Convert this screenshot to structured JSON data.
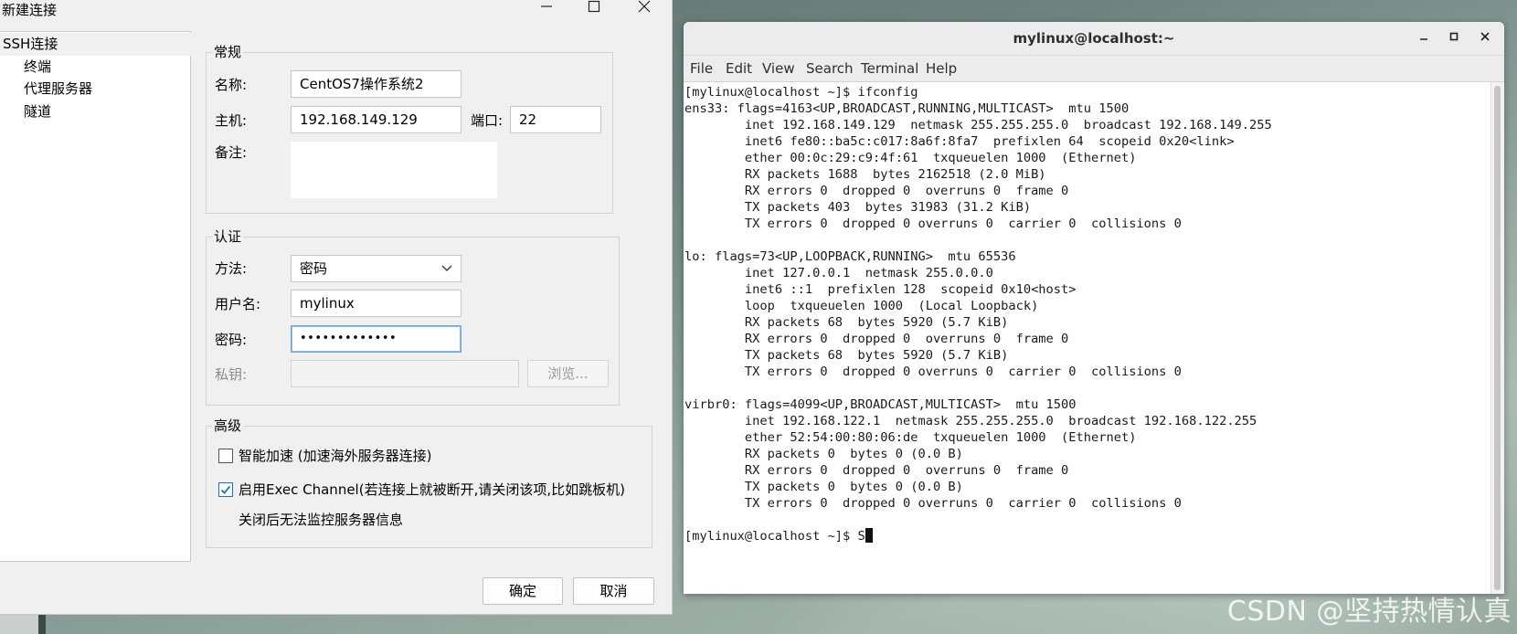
{
  "dialog": {
    "title": "新建连接",
    "tree": [
      "SSH连接",
      "终端",
      "代理服务器",
      "隧道"
    ],
    "general": {
      "title": "常规",
      "name_label": "名称:",
      "name_value": "CentOS7操作系统2",
      "host_label": "主机:",
      "host_value": "192.168.149.129",
      "port_label": "端口:",
      "port_value": "22",
      "note_label": "备注:"
    },
    "auth": {
      "title": "认证",
      "method_label": "方法:",
      "method_value": "密码",
      "user_label": "用户名:",
      "user_value": "mylinux",
      "password_label": "密码:",
      "password_value": "•••••••••••••",
      "key_label": "私钥:",
      "browse_label": "浏览..."
    },
    "advanced": {
      "title": "高级",
      "smart_accel_label": "智能加速 (加速海外服务器连接)",
      "smart_accel_checked": false,
      "exec_channel_label": "启用Exec Channel(若连接上就被断开,请关闭该项,比如跳板机)",
      "exec_channel_checked": true,
      "exec_channel_note": "关闭后无法监控服务器信息"
    },
    "ok_label": "确定",
    "cancel_label": "取消"
  },
  "terminal": {
    "title": "mylinux@localhost:~",
    "menu": [
      "File",
      "Edit",
      "View",
      "Search",
      "Terminal",
      "Help"
    ],
    "lines": [
      "[mylinux@localhost ~]$ ifconfig",
      "ens33: flags=4163<UP,BROADCAST,RUNNING,MULTICAST>  mtu 1500",
      "        inet 192.168.149.129  netmask 255.255.255.0  broadcast 192.168.149.255",
      "        inet6 fe80::ba5c:c017:8a6f:8fa7  prefixlen 64  scopeid 0x20<link>",
      "        ether 00:0c:29:c9:4f:61  txqueuelen 1000  (Ethernet)",
      "        RX packets 1688  bytes 2162518 (2.0 MiB)",
      "        RX errors 0  dropped 0  overruns 0  frame 0",
      "        TX packets 403  bytes 31983 (31.2 KiB)",
      "        TX errors 0  dropped 0 overruns 0  carrier 0  collisions 0",
      "",
      "lo: flags=73<UP,LOOPBACK,RUNNING>  mtu 65536",
      "        inet 127.0.0.1  netmask 255.0.0.0",
      "        inet6 ::1  prefixlen 128  scopeid 0x10<host>",
      "        loop  txqueuelen 1000  (Local Loopback)",
      "        RX packets 68  bytes 5920 (5.7 KiB)",
      "        RX errors 0  dropped 0  overruns 0  frame 0",
      "        TX packets 68  bytes 5920 (5.7 KiB)",
      "        TX errors 0  dropped 0 overruns 0  carrier 0  collisions 0",
      "",
      "virbr0: flags=4099<UP,BROADCAST,MULTICAST>  mtu 1500",
      "        inet 192.168.122.1  netmask 255.255.255.0  broadcast 192.168.122.255",
      "        ether 52:54:00:80:06:de  txqueuelen 1000  (Ethernet)",
      "        RX packets 0  bytes 0 (0.0 B)",
      "        RX errors 0  dropped 0  overruns 0  frame 0",
      "        TX packets 0  bytes 0 (0.0 B)",
      "        TX errors 0  dropped 0 overruns 0  carrier 0  collisions 0",
      ""
    ],
    "prompt": "[mylinux@localhost ~]$ S"
  },
  "watermark": "CSDN @坚持热情认真",
  "colors": {
    "checkbox_accent": "#1a73c8",
    "focus_border": "#6fa7da"
  }
}
